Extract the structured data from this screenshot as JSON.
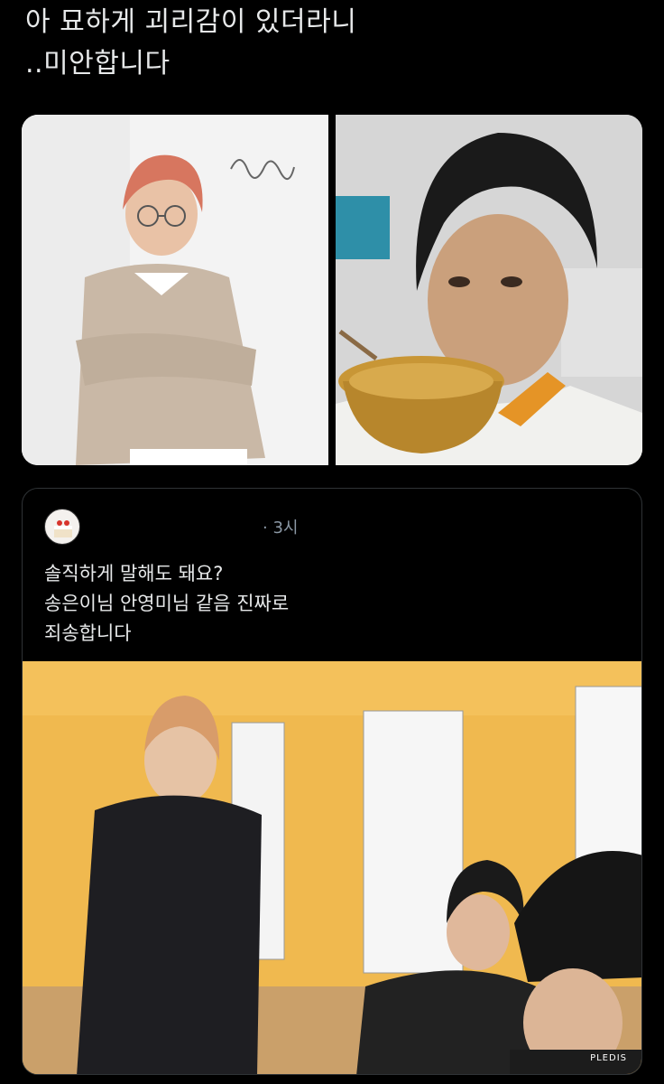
{
  "tweet": {
    "lines": [
      "아 묘하게 괴리감이 있더라니",
      "..미안합니다"
    ]
  },
  "images": [
    {
      "name": "portrait-photo-signed",
      "alt": ""
    },
    {
      "name": "selfie-drinking-photo",
      "alt": ""
    }
  ],
  "quote": {
    "timestamp": "· 3시",
    "lines": [
      "솔직하게 말해도 돼요?",
      "송은이님 안영미님 같음 진짜로",
      "죄송합니다"
    ],
    "media_watermark": "PLEDIS"
  },
  "colors": {
    "background": "#000000",
    "text": "#e7e9ea",
    "muted": "#8b98a5",
    "border": "#2f3336"
  }
}
